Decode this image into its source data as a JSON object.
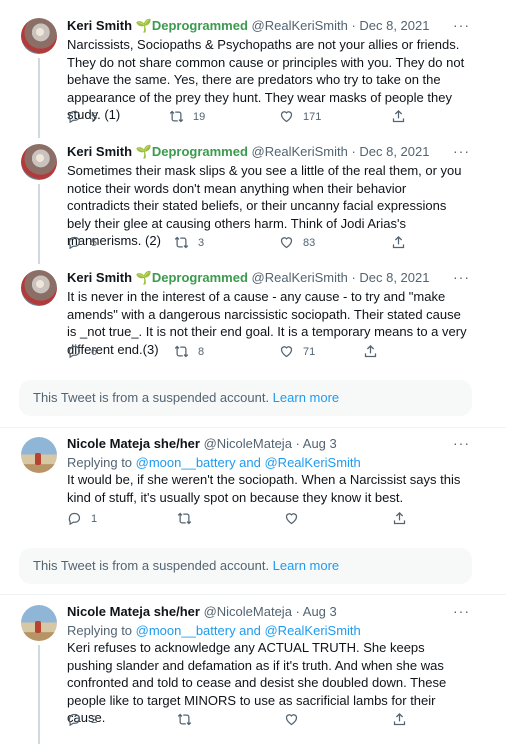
{
  "tweets": [
    {
      "name": "Keri Smith",
      "badge": "🌱Deprogrammed",
      "handle": "@RealKeriSmith",
      "date": "· Dec 8, 2021",
      "text": "Narcissists, Sociopaths & Psychopaths are not your allies or friends. They do not share common cause or principles with you. They do not behave the same. Yes, there are predators who try to take on the appearance of the prey they hunt. They wear masks of people they study. (1)",
      "replies": "5",
      "retweets": "19",
      "likes": "171"
    },
    {
      "name": "Keri Smith",
      "badge": "🌱Deprogrammed",
      "handle": "@RealKeriSmith",
      "date": "· Dec 8, 2021",
      "text": "Sometimes their mask slips & you see a little of the real them, or you notice their words don't mean anything when their behavior contradicts their stated beliefs, or their uncanny facial expressions bely their glee at causing others harm. Think of Jodi Arias's mannerisms. (2)",
      "replies": "5",
      "retweets": "3",
      "likes": "83"
    },
    {
      "name": "Keri Smith",
      "badge": "🌱Deprogrammed",
      "handle": "@RealKeriSmith",
      "date": "· Dec 8, 2021",
      "text": "It is never in the interest of a cause - any cause - to try and \"make amends\" with a dangerous narcissistic sociopath. Their stated cause is _not true_. It is not their end goal. It is a temporary means to a very different end.(3)",
      "replies": "6",
      "retweets": "8",
      "likes": "71"
    },
    {
      "name": "Nicole Mateja she/her",
      "handle": "@NicoleMateja",
      "date": "· Aug 3",
      "replying_prefix": "Replying to ",
      "replying_users": "@moon__battery and @RealKeriSmith",
      "text": "It would be, if she weren't the sociopath. When a Narcissist says this kind of stuff, it's usually spot on because they know it best.",
      "replies": "1",
      "retweets": "",
      "likes": ""
    },
    {
      "name": "Nicole Mateja she/her",
      "handle": "@NicoleMateja",
      "date": "· Aug 3",
      "replying_prefix": "Replying to ",
      "replying_users": "@moon__battery and @RealKeriSmith",
      "text": "Keri refuses to acknowledge any ACTUAL TRUTH. She keeps pushing slander and defamation as if it's truth. And when she was confronted and told to cease and desist she doubled down. These people like to target MINORS to use as sacrificial lambs for their cause.",
      "replies": "2",
      "retweets": "",
      "likes": ""
    }
  ],
  "suspended": {
    "text": "This Tweet is from a suspended account. ",
    "link": "Learn more"
  },
  "more_glyph": "···",
  "icons": {
    "reply": "reply-icon",
    "retweet": "retweet-icon",
    "like": "heart-icon",
    "share": "share-icon"
  },
  "colors": {
    "link": "#1d9bf0",
    "secondary": "#536471",
    "sprout": "#3a9b4e"
  }
}
